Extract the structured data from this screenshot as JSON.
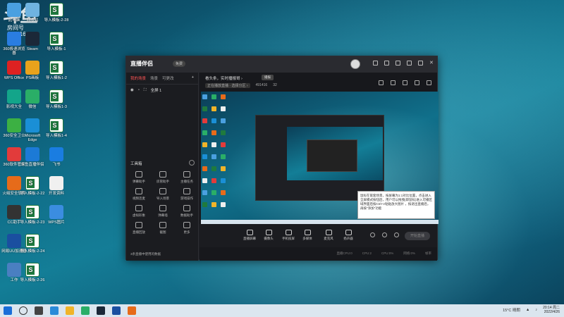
{
  "watermark": {
    "brand": "斗鱼",
    "room_label": "房间号",
    "room_id": "6914166"
  },
  "desktop": {
    "icons_col1": [
      {
        "label": "此电脑",
        "icon": "computer-icon",
        "color": "#4aa0e0"
      },
      {
        "label": "360极速浏览器",
        "icon": "browser-icon",
        "color": "#2a7de1"
      },
      {
        "label": "WPS Office",
        "icon": "wps-icon",
        "color": "#d22"
      },
      {
        "label": "影视大全",
        "icon": "video-icon",
        "color": "#13a58a"
      },
      {
        "label": "360安全卫士",
        "icon": "shield-icon",
        "color": "#3cb043"
      },
      {
        "label": "360软件管家",
        "icon": "apps-icon",
        "color": "#e23b3b"
      },
      {
        "label": "火绒安全软件",
        "icon": "fire-shield-icon",
        "color": "#e66b1a"
      },
      {
        "label": "CC助手",
        "icon": "cc-icon",
        "color": "#333"
      },
      {
        "label": "网易UU加速器",
        "icon": "uu-icon",
        "color": "#1a4fa0"
      },
      {
        "label": "工作",
        "icon": "file-icon",
        "color": "#4a7fc1"
      }
    ],
    "icons_col2": [
      {
        "label": "回收站",
        "icon": "recycle-bin-icon",
        "color": "#6fb3e0"
      },
      {
        "label": "Steam",
        "icon": "steam-icon",
        "color": "#1b2838"
      },
      {
        "label": "PS画板",
        "icon": "ps-icon",
        "color": "#e8a21c"
      },
      {
        "label": "微信",
        "icon": "wechat-icon",
        "color": "#2aae67"
      },
      {
        "label": "Microsoft Edge",
        "icon": "edge-icon",
        "color": "#1a8fd6"
      },
      {
        "label": "斗鱼直播伴侣",
        "icon": "douyu-icon",
        "color": "#1c7ad6"
      },
      {
        "label": "导入模板-2-22",
        "icon": "excel-icon",
        "color": "#1f7a3e"
      },
      {
        "label": "导入模板-2-23",
        "icon": "excel-icon",
        "color": "#1f7a3e"
      },
      {
        "label": "导入模板-2-24",
        "icon": "excel-icon",
        "color": "#1f7a3e"
      },
      {
        "label": "导入模板-2-26",
        "icon": "excel-icon",
        "color": "#1f7a3e"
      }
    ],
    "icons_col3": [
      {
        "label": "导入模板-2-28",
        "icon": "excel-icon",
        "color": "#1f7a3e"
      },
      {
        "label": "导入模板-1",
        "icon": "excel-icon",
        "color": "#1f7a3e"
      },
      {
        "label": "导入模板1-2",
        "icon": "excel-icon",
        "color": "#1f7a3e"
      },
      {
        "label": "导入模板1-3",
        "icon": "excel-icon",
        "color": "#1f7a3e"
      },
      {
        "label": "导入模板1-4",
        "icon": "excel-icon",
        "color": "#1f7a3e"
      },
      {
        "label": "飞书",
        "icon": "feishu-icon",
        "color": "#1a7de1"
      },
      {
        "label": "开发资料",
        "icon": "doc-icon",
        "color": "#f0f0f0"
      },
      {
        "label": "WPS图片",
        "icon": "image-icon",
        "color": "#3b8de0"
      }
    ]
  },
  "app": {
    "logo": "直播伴侣",
    "logo_badge": "免费",
    "tabs": [
      "我的场景",
      "场景",
      "可更改"
    ],
    "scene_name": "全屏 1",
    "notice": "看头条，实时播报哥 ›",
    "notice_btn": "播报",
    "meta_badge": "正在播放直播 · 选择分区 ›",
    "meta_id": "491416",
    "meta_count": "32",
    "toolbox_title": "工具箱",
    "tools": [
      {
        "label": "弹幕助手",
        "icon": "danmu-icon"
      },
      {
        "label": "房管助手",
        "icon": "admin-icon"
      },
      {
        "label": "主播任务",
        "icon": "task-icon"
      },
      {
        "label": "视频连麦",
        "icon": "video-call-icon"
      },
      {
        "label": "导入场景",
        "icon": "import-icon"
      },
      {
        "label": "游戏操作",
        "icon": "gamepad-icon"
      },
      {
        "label": "虚拟形象",
        "icon": "avatar-icon"
      },
      {
        "label": "弹幕墙",
        "icon": "wall-icon"
      },
      {
        "label": "数据助手",
        "icon": "data-icon"
      },
      {
        "label": "直播回放",
        "icon": "replay-icon"
      },
      {
        "label": "截图",
        "icon": "screenshot-icon"
      },
      {
        "label": "更多",
        "icon": "more-icon"
      }
    ],
    "left_footer": "3条直播中使用的数据",
    "bottom_tools": [
      {
        "label": "直播屏幕",
        "icon": "screen-icon"
      },
      {
        "label": "摄像头",
        "icon": "camera-icon"
      },
      {
        "label": "手机投屏",
        "icon": "phone-icon"
      },
      {
        "label": "多媒体",
        "icon": "media-icon"
      },
      {
        "label": "麦克风",
        "icon": "mic-icon"
      },
      {
        "label": "扬声器",
        "icon": "speaker-icon"
      }
    ],
    "live_button": "开始直播",
    "status": [
      "直播CPU:0",
      "CPU:2",
      "CPU:0%",
      "网络:0%",
      "帧率"
    ],
    "tooltip": "鼠标在嵌套场景，按屏幕为1:1对比位置，点击进入全屏模式按钮后，用户可以拖拽(即鼠标)进入可播区域界面后按Ctrl+V粘贴放大图片 ，按退出直播后，再按\"添加\"功能"
  },
  "taskbar": {
    "weather": "15°C 晴朗",
    "time": "20:14 周二",
    "date": "2022/4/26"
  }
}
